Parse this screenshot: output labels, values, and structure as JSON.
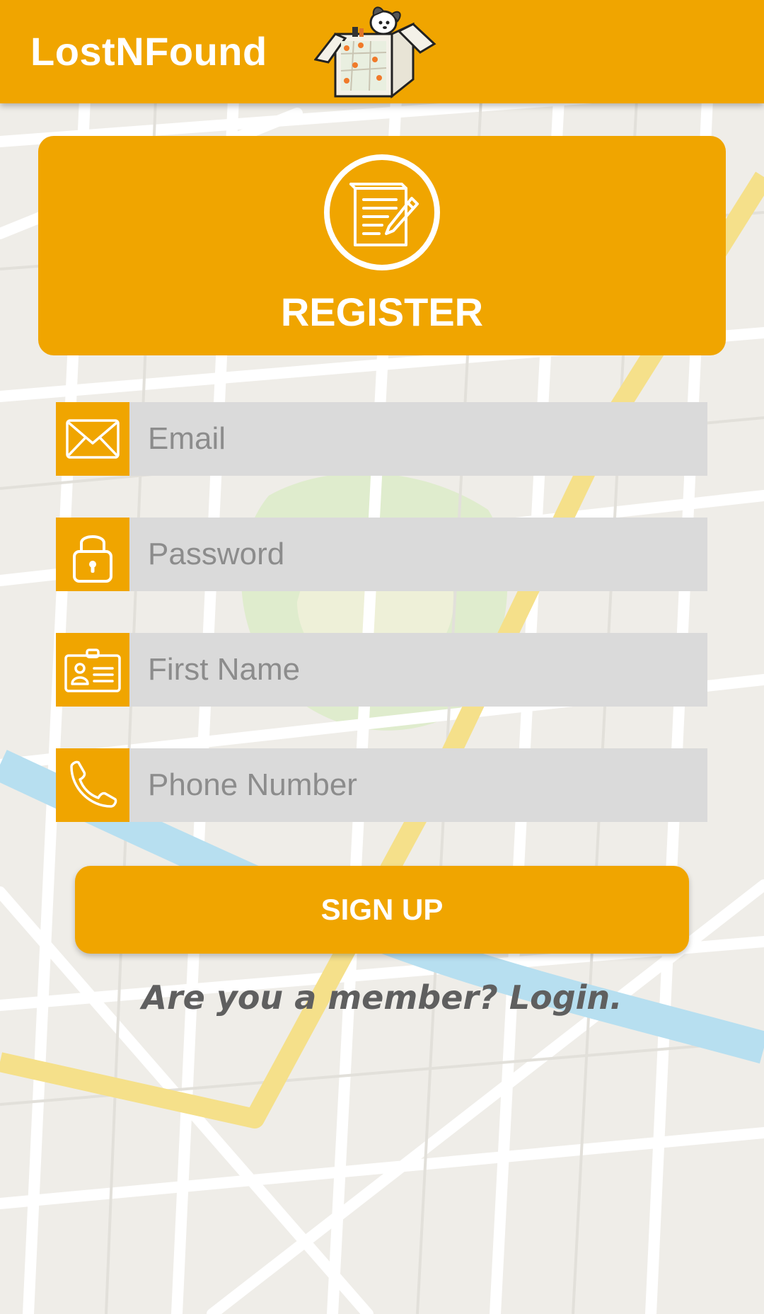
{
  "app_bar": {
    "title": "LostNFound"
  },
  "register_card": {
    "title": "REGISTER"
  },
  "form": {
    "email_placeholder": "Email",
    "password_placeholder": "Password",
    "first_name_placeholder": "First Name",
    "phone_placeholder": "Phone Number"
  },
  "actions": {
    "signup_label": "SIGN UP",
    "login_link": "Are you a member? Login."
  },
  "colors": {
    "accent": "#f0a500",
    "input_bg": "#dadada",
    "map_bg": "#efede8",
    "text_muted": "#5f5f5f"
  },
  "icons": {
    "logo": "box-with-dog-logo",
    "register": "document-pencil-icon",
    "email": "envelope-icon",
    "password": "lock-icon",
    "first_name": "id-card-icon",
    "phone": "phone-icon"
  }
}
